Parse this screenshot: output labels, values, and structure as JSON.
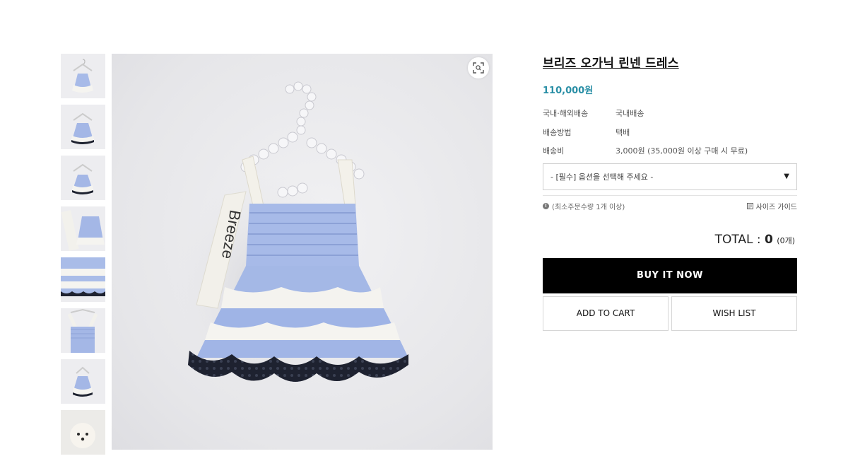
{
  "product": {
    "title": "브리즈 오가닉 린넨 드레스",
    "price": "110,000원",
    "info_rows": [
      {
        "label": "국내·해외배송",
        "value": "국내배송"
      },
      {
        "label": "배송방법",
        "value": "택배"
      },
      {
        "label": "배송비",
        "value": "3,000원 (35,000원 이상 구매 시 무료)"
      }
    ],
    "option_select": {
      "selected": "- [필수] 옵션을 선택해 주세요 -"
    },
    "min_order_note": "(최소주문수량 1개 이상)",
    "size_guide_label": "사이즈 가이드",
    "total": {
      "label": "TOTAL : ",
      "value": "0",
      "count": "(0개)"
    },
    "buttons": {
      "buy_now": "BUY IT NOW",
      "add_to_cart": "ADD TO CART",
      "wish_list": "WISH LIST"
    }
  },
  "gallery": {
    "thumbnail_count": 8,
    "main_image_text": "Breeze",
    "zoom_icon": "zoom-icon",
    "colors": {
      "dress_blue": "#9fb4e6",
      "ruffle_white": "#f4f3ef",
      "lace_black": "#1e2230",
      "price_teal": "#2a8fa6"
    }
  }
}
